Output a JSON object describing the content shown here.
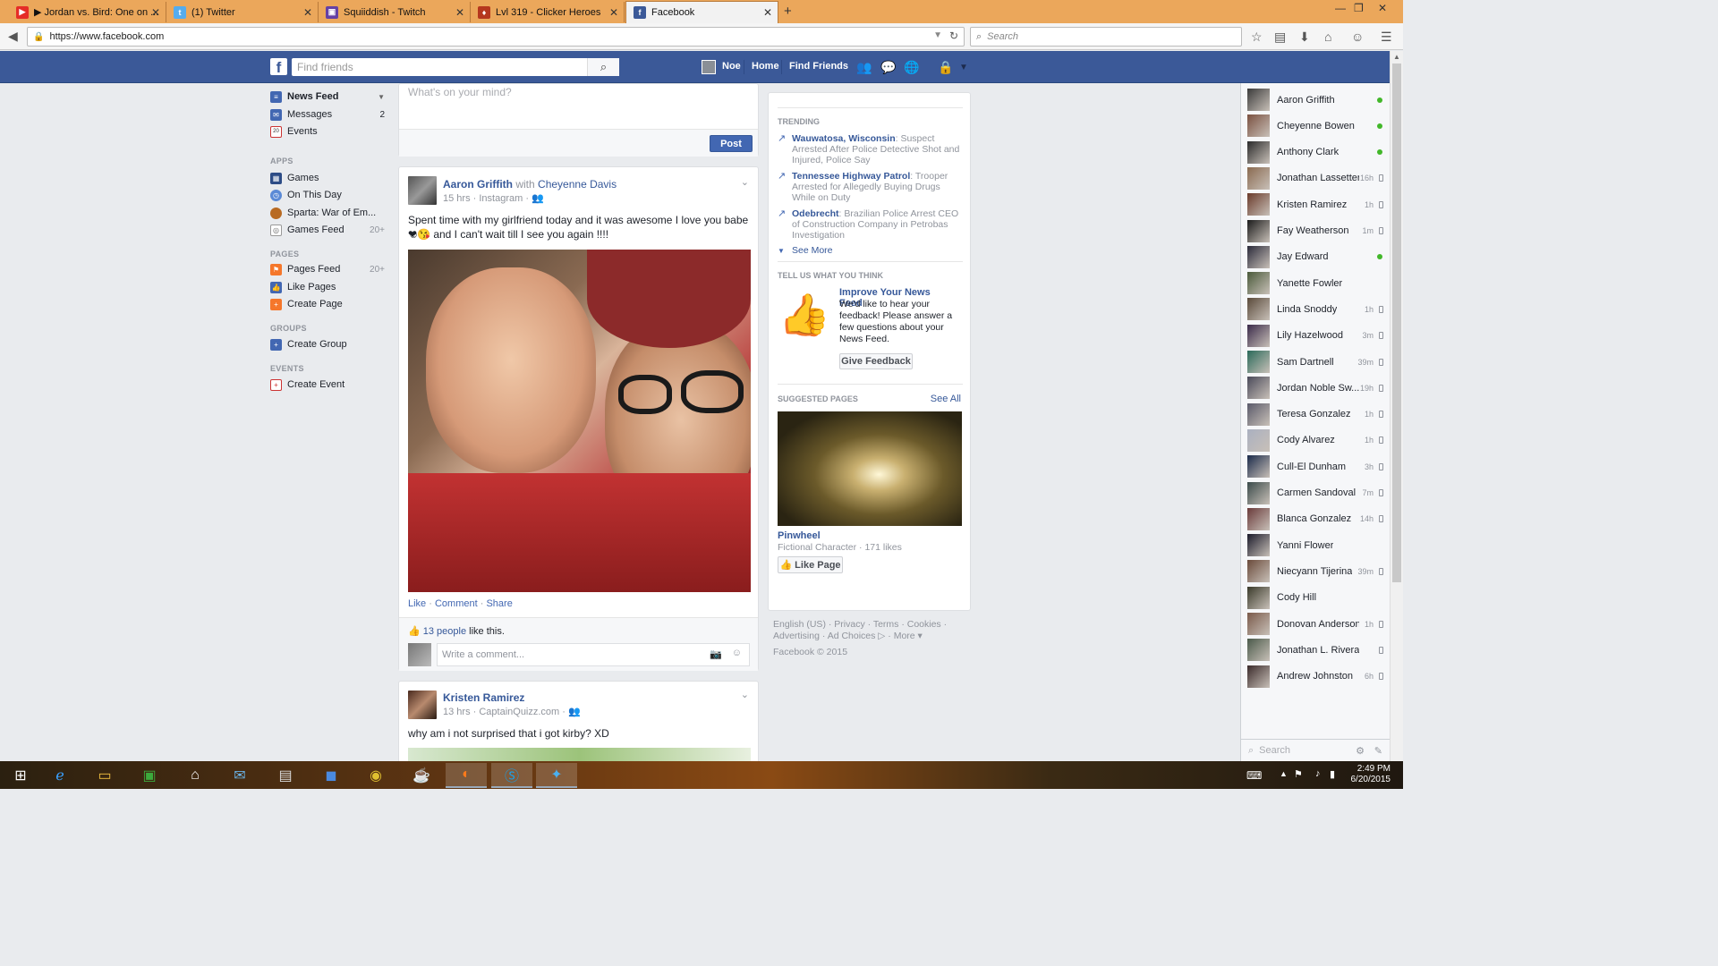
{
  "browser": {
    "tabs": [
      {
        "label": "▶ Jordan vs. Bird: One on ...",
        "icon": "youtube-icon",
        "color": "#e52d27"
      },
      {
        "label": "(1) Twitter",
        "icon": "twitter-icon",
        "color": "#55acee"
      },
      {
        "label": "Squiiddish - Twitch",
        "icon": "twitch-icon",
        "color": "#6441a5"
      },
      {
        "label": "Lvl 319 - Clicker Heroes",
        "icon": "clicker-heroes-icon",
        "color": "#b5371e"
      },
      {
        "label": "Facebook",
        "icon": "facebook-icon",
        "color": "#3b5998",
        "active": true
      }
    ],
    "url": "https://www.facebook.com",
    "search_placeholder": "Search"
  },
  "fb_header": {
    "search_placeholder": "Find friends",
    "user_name": "Noe",
    "home": "Home",
    "find_friends": "Find Friends"
  },
  "left_nav": {
    "favorites": [
      {
        "label": "News Feed",
        "bold": true
      },
      {
        "label": "Messages",
        "count": "2"
      },
      {
        "label": "Events",
        "icon_text": "20"
      }
    ],
    "apps_heading": "APPS",
    "apps": [
      {
        "label": "Games"
      },
      {
        "label": "On This Day"
      },
      {
        "label": "Sparta: War of Em..."
      },
      {
        "label": "Games Feed",
        "count": "20+"
      }
    ],
    "pages_heading": "PAGES",
    "pages": [
      {
        "label": "Pages Feed",
        "count": "20+"
      },
      {
        "label": "Like Pages"
      },
      {
        "label": "Create Page"
      }
    ],
    "groups_heading": "GROUPS",
    "groups": [
      {
        "label": "Create Group"
      }
    ],
    "events_heading": "EVENTS",
    "events": [
      {
        "label": "Create Event"
      }
    ]
  },
  "composer": {
    "placeholder": "What's on your mind?",
    "post_button": "Post"
  },
  "post1": {
    "author": "Aaron Griffith",
    "with_word": "with",
    "tagged": "Cheyenne Davis",
    "meta": "15 hrs · Instagram ·",
    "text_line1": "Spent time with my girlfriend today and it was awesome I love you babe ☺",
    "text_line2": "❤😘 and I can't wait till I see you again !!!!",
    "action_like": "Like",
    "action_comment": "Comment",
    "action_share": "Share",
    "likes_people": "13 people",
    "likes_suffix": "like this.",
    "comment_placeholder": "Write a comment..."
  },
  "post2": {
    "author": "Kristen Ramirez",
    "meta": "13 hrs · CaptainQuizz.com ·",
    "text": "why am i not surprised that i got kirby? XD"
  },
  "right_col": {
    "trending_heading": "TRENDING",
    "trending": [
      {
        "topic": "Wauwatosa, Wisconsin",
        "desc": ": Suspect Arrested After Police Detective Shot and Injured, Police Say"
      },
      {
        "topic": "Tennessee Highway Patrol",
        "desc": ": Trooper Arrested for Allegedly Buying Drugs While on Duty"
      },
      {
        "topic": "Odebrecht",
        "desc": ": Brazilian Police Arrest CEO of Construction Company in Petrobas Investigation"
      }
    ],
    "see_more": "See More",
    "feedback_heading": "TELL US WHAT YOU THINK",
    "feedback_title": "Improve Your News Feed",
    "feedback_text": "We'd like to hear your feedback! Please answer a few questions about your News Feed.",
    "feedback_button": "Give Feedback",
    "suggested_heading": "SUGGESTED PAGES",
    "see_all": "See All",
    "suggested_name": "Pinwheel",
    "suggested_meta": "Fictional Character · 171 likes",
    "like_page": "Like Page",
    "footer_line1": "English (US) · Privacy · Terms · Cookies ·",
    "footer_line2": "Advertising · Ad Choices ▷ · More ▾",
    "footer_copy": "Facebook © 2015"
  },
  "chat": {
    "contacts": [
      {
        "name": "Aaron Griffith",
        "status": "online"
      },
      {
        "name": "Cheyenne Bowen",
        "status": "online"
      },
      {
        "name": "Anthony Clark",
        "status": "online"
      },
      {
        "name": "Jonathan Lassetter",
        "time": "16h",
        "status": "mobile"
      },
      {
        "name": "Kristen Ramirez",
        "time": "1h",
        "status": "mobile"
      },
      {
        "name": "Fay Weatherson",
        "time": "1m",
        "status": "mobile"
      },
      {
        "name": "Jay Edward",
        "status": "online"
      },
      {
        "name": "Yanette Fowler"
      },
      {
        "name": "Linda Snoddy",
        "time": "1h",
        "status": "mobile"
      },
      {
        "name": "Lily Hazelwood",
        "time": "3m",
        "status": "mobile"
      },
      {
        "name": "Sam Dartnell",
        "time": "39m",
        "status": "mobile"
      },
      {
        "name": "Jordan Noble Sw...",
        "time": "19h",
        "status": "mobile"
      },
      {
        "name": "Teresa Gonzalez",
        "time": "1h",
        "status": "mobile"
      },
      {
        "name": "Cody Alvarez",
        "time": "1h",
        "status": "mobile"
      },
      {
        "name": "Cull-El Dunham",
        "time": "3h",
        "status": "mobile"
      },
      {
        "name": "Carmen Sandoval ...",
        "time": "7m",
        "status": "mobile"
      },
      {
        "name": "Blanca Gonzalez",
        "time": "14h",
        "status": "mobile"
      },
      {
        "name": "Yanni Flower"
      },
      {
        "name": "Niecyann Tijerina",
        "time": "39m",
        "status": "mobile"
      },
      {
        "name": "Cody Hill"
      },
      {
        "name": "Donovan Anderson",
        "time": "1h",
        "status": "mobile"
      },
      {
        "name": "Jonathan L. Rivera",
        "status": "mobile"
      },
      {
        "name": "Andrew Johnston",
        "time": "6h",
        "status": "mobile"
      }
    ],
    "search_placeholder": "Search"
  },
  "taskbar": {
    "time": "2:49 PM",
    "date": "6/20/2015"
  }
}
